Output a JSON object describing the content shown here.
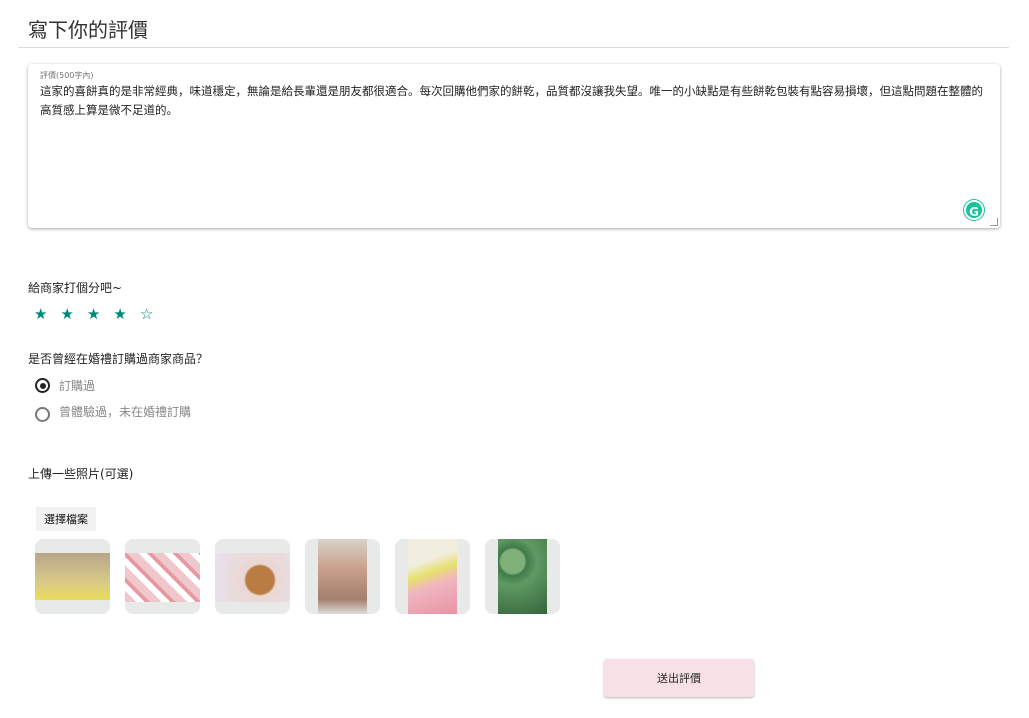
{
  "header": {
    "title": "寫下你的評價"
  },
  "review": {
    "label": "評價(500字內)",
    "value": "這家的喜餅真的是非常經典，味道穩定，無論是給長輩還是朋友都很適合。每次回購他們家的餅乾，品質都沒讓我失望。唯一的小缺點是有些餅乾包裝有點容易損壞，但這點問題在整體的高質感上算是微不足道的。",
    "grammarly_icon": "G"
  },
  "rating": {
    "label": "給商家打個分吧~",
    "value": 4,
    "max": 5,
    "color": "#00897b"
  },
  "purchase": {
    "question": "是否曾經在婚禮訂購過商家商品？",
    "options": [
      {
        "label": "訂購過",
        "selected": true
      },
      {
        "label": "曾體驗過，未在婚禮訂購",
        "selected": false
      }
    ]
  },
  "upload": {
    "label": "上傳一些照片(可選)",
    "button": "選擇檔案",
    "photo_count": 6
  },
  "submit": {
    "label": "送出評價",
    "color": "#f8e1e6"
  }
}
